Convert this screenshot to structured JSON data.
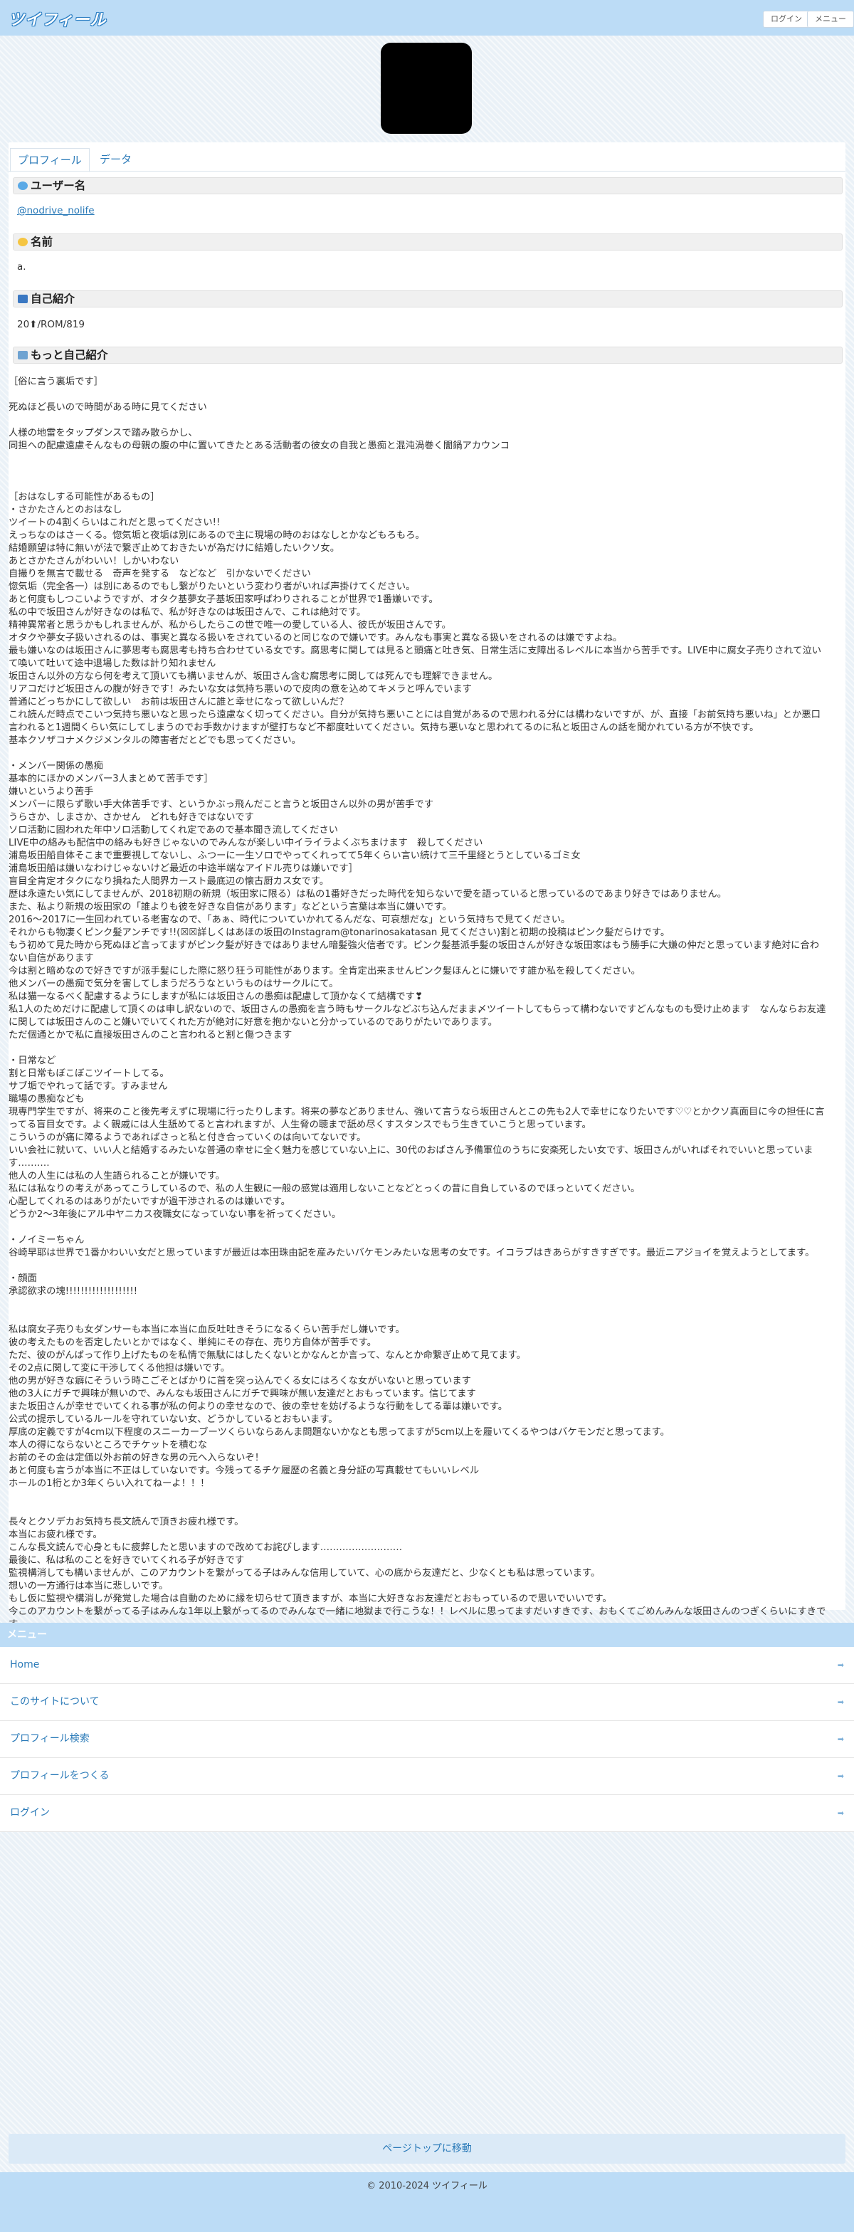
{
  "header": {
    "logo": "ツイフィール",
    "login_label": "ログイン",
    "menu_label": "メニュー"
  },
  "tabs": [
    {
      "label": "プロフィール"
    },
    {
      "label": "データ"
    }
  ],
  "profile": {
    "username_heading": "ユーザー名",
    "username": "@nodrive_nolife",
    "name_heading": "名前",
    "name": "a.",
    "bio_heading": "自己紹介",
    "bio": "20⬆/ROM/819",
    "more_heading": "もっと自己紹介",
    "more_intro": "［俗に言う裏垢です］\n\n死ぬほど長いので時間がある時に見てください\n\n人様の地雷をタップダンスで踏み散らかし、\n同担への配慮遠慮そんなもの母親の腹の中に置いてきたとある活動者の彼女の自我と愚痴と混沌渦巻く闇鍋アカウンコ\n\n\n\n［おはなしする可能性があるもの］\n・さかたさんとのおはなし\nツイートの4割くらいはこれだと思ってください!!\nえっちなのはさーくる。惚気垢と夜垢は別にあるので主に現場の時のおはなしとかなどもろもろ。\n結婚願望は特に無いが法で繋ぎ止めておきたいが為だけに結婚したいクソ女。\nあとさかたさんがわいい！しかいわない\n自撮りを無言で載せる　奇声を発する　などなど　引かないでください\n惚気垢（完全各一）は別にあるのでもし繋がりたいという変わり者がいれば声掛けてください。\nあと何度もしつこいようですが、オタク基夢女子基坂田家呼ばわりされることが世界で1番嫌いです。\n私の中で坂田さんが好きなのは私で、私が好きなのは坂田さんで、これは絶対です。\n精神異常者と思うかもしれませんが、私からしたらこの世で唯一の愛している人、彼氏が坂田さんです。\nオタクや夢女子扱いされるのは、事実と異なる扱いをされているのと同じなので嫌いです。みんなも事実と異なる扱いをされるのは嫌ですよね。\n最も嫌いなのは坂田さんに夢思考も腐思考も持ち合わせている女です。腐思考に関しては見ると頭痛と吐き気、日常生活に支障出るレベルに本当から苦手です。LIVE中に腐女子売りされて泣いて喚いて吐いて途中退場した数は計り知れません\n坂田さん以外の方なら何を考えて頂いても構いませんが、坂田さん含む腐思考に関しては死んでも理解できません。\nリアコだけど坂田さんの腹が好きです！みたいな女は気持ち悪いので皮肉の意を込めてキメラと呼んでいます\n普通にどっちかにして欲しい　お前は坂田さんに誰と幸せになって欲しいんだ？\nこれ読んだ時点でこいつ気持ち悪いなと思ったら遠慮なく切ってください。自分が気持ち悪いことには自覚があるので思われる分には構わないですが、が、直接「お前気持ち悪いね」とか悪口言われると1週間くらい気にしてしまうのでお手数かけますが壁打ちなど不都度吐いてください。気持ち悪いなと思われてるのに私と坂田さんの話を聞かれている方が不快です。\n基本クソザコナメクジメンタルの障害者だとどでも思ってください。\n\n・メンバー関係の愚痴\n基本的にほかのメンバー3人まとめて苦手です］\n嫌いというより苦手\nメンバーに限らず歌い手大体苦手です、というかぶっ飛んだこと言うと坂田さん以外の男が苦手です\nうらさか、しまさか、さかせん　どれも好きではないです\nソロ活動に固われた年中ソロ活動してくれ定であので基本聞き流してください\nLIVE中の絡みも配信中の絡みも好きじゃないのでみんなが楽しい中イライラよくぶちまけます　殺してください\n浦島坂田船自体そこまで重要視してないし、ふつーに一生ソロでやってくれってて5年くらい言い続けて三千里経とうとしているゴミ女\n浦島坂田船は嫌いなわけじゃないけど最近の中途半端なアイドル売りは嫌いです］\n盲目全肯定オタクになり損ねた人間界カースト最底辺の懐古厨カス女です。\n歴は永遠たい気にしてませんが、2018初期の新規（坂田家に限る）は私の1番好きだった時代を知らないで愛を語っていると思っているのであまり好きではありません。\nまた、私より新規の坂田家の「誰よりも彼を好きな自信があります」などという言葉は本当に嫌いです。\n2016〜2017に一生回われている老害なので、「あぁ、時代についていかれてるんだな、可哀想だな」という気持ちで見てください。\nそれからも物凄くピンク髪アンチです!!(☒☒詳しくはあほの坂田のInstagram@tonarinosakatasan 見てください)割と初期の投稿はピンク髪だらけです。\nもう初めて見た時から死ぬほど言ってますがピンク髪が好きではありません暗髪強火信者です。ピンク髪基派手髪の坂田さんが好きな坂田家はもう勝手に大嫌の仲だと思っています絶対に合わない自信があります\n今は割と暗めなので好きですが派手髪にした際に怒り狂う可能性があります。全肯定出来ませんピンク髪ほんとに嫌いです誰か私を殺してください。\n他メンバーの愚痴で気分を害してしまうだろうなというものはサークルにて。\n私は猫一なるべく配慮するようにしますが私には坂田さんの愚痴は配慮して頂かなくて結構です❣\n私1人のためだけに配慮して頂くのは申し訳ないので、坂田さんの愚痴を言う時もサークルなどぶち込んだまま〆ツイートしてもらって構わないですどんなものも受け止めます　なんならお友達に関しては坂田さんのこと嫌いでいてくれた方が絶対に好意を抱かないと分かっているのでありがたいであります。\nただ個通とかで私に直接坂田さんのこと言われると割と傷つきます\n\n・日常など\n割と日常もぼこぼこツイートしてる。\nサブ垢でやれって話です。すみません\n職場の愚痴なども\n現専門学生ですが、将来のこと後先考えずに現場に行ったりします。将来の夢などありません、強いて言うなら坂田さんとこの先も2人で幸せになりたいです♡♡とかクソ真面目に今の担任に言ってる盲目女です。よく親戚には人生舐めてると言われますが、人生脅の聴まで舐め尽くすスタンスでもう生きていこうと思っています。\nこういうのが痛に障るようであればさっと私と付き合っていくのは向いてないです。\nいい会社に就いて、いい人と結婚するみたいな普通の幸せに全く魅力を感じていない上に、30代のおばさん予備軍位のうちに安楽死したい女です、坂田さんがいればそれでいいと思っています‥‥‥‥‥\n他人の人生には私の人生語られることが嫌いです。\n私には私なりの考えがあってこうしているので、私の人生観に一般の感覚は適用しないことなどとっくの昔に自負しているのでほっといてください。\n心配してくれるのはありがたいですが過干渉されるのは嫌いです。\nどうか2〜3年後にアル中ヤニカス夜職女になっていない事を祈ってください。\n\n・ノイミーちゃん\n谷崎早耶は世界で1番かわいい女だと思っていますが最近は本田珠由記を産みたいバケモンみたいな思考の女です。イコラブはきあらがすきすぎです。最近ニアジョイを覚えようとしてます。\n\n・顔面\n承認欲求の塊!!!!!!!!!!!!!!!!!!!\n\n\n私は腐女子売りも女ダンサーも本当に本当に血反吐吐きそうになるくらい苦手だし嫌いです。\n彼の考えたものを否定したいとかではなく、単純にその存在、売り方自体が苦手です。\nただ、彼のがんばって作り上げたものを私情で無駄にはしたくないとかなんとか言って、なんとか命繋ぎ止めて見てます。\nその2点に関して変に干渉してくる他担は嫌いです。\n他の男が好きな癖にそういう時こごそとばかりに首を突っ込んでくる女にはろくな女がいないと思っています\n他の3人にガチで興味が無いので、みんなも坂田さんにガチで興味が無い友達だとおもっています。信じてます\nまた坂田さんが幸せでいてくれる事が私の何よりの幸せなので、彼の幸せを妨げるような行動をしてる輩は嫌いです。\n公式の提示しているルールを守れていない女、どうかしているとおもいます。\n厚底の定義ですが4cm以下程度のスニーカーブーツくらいならあんま問題ないかなとも思ってますが5cm以上を履いてくるやつはバケモンだと思ってます。\n本人の得にならないところでチケットを積むな\nお前のその金は定価以外お前の好きな男の元へ入らないぞ！\nあと何度も言うが本当に不正はしていないです。今残ってるチケ履歴の名義と身分証の写真載せてもいいレベル\nホールの1桁とか3年くらい入れてねーよ！！！\n\n\n長々とクソデカお気持ち長文読んで頂きお疲れ様です。\n本当にお疲れ様です。\nこんな長文読んで心身ともに疲弊したと思いますので改めてお詫びします‥‥‥‥‥‥‥‥‥‥‥‥‥\n最後に、私は私のことを好きでいてくれる子が好きです\n監視構消しても構いませんが、このアカウントを繋がってる子はみんな信用していて、心の底から友達だと、少なくとも私は思っています。\n想いの一方通行は本当に悲しいです。\nもし仮に監視や構消しが発覚した場合は自動のために縁を切らせて頂きますが、本当に大好きなお友達だとおもっているので思いでいいです。\n今このアカウントを繋がってる子はみんな1年以上繋がってるのでみんなで一緒に地獄まで行こうな！！レベルに思ってますだいすきです、おもくてごめんみんな坂田さんのつぎくらいにすきです"
  },
  "menu": {
    "heading": "メニュー",
    "items": [
      {
        "label": "Home"
      },
      {
        "label": "このサイトについて"
      },
      {
        "label": "プロフィール検索"
      },
      {
        "label": "プロフィールをつくる"
      },
      {
        "label": "ログイン"
      }
    ],
    "arrow": "➡"
  },
  "page_top_label": "ページトップに移動",
  "footer": "© 2010-2024 ツイフィール",
  "colors": {
    "accent": "#2a7ab8",
    "header_bg": "#bcdcf6",
    "avatar": "#000000"
  }
}
